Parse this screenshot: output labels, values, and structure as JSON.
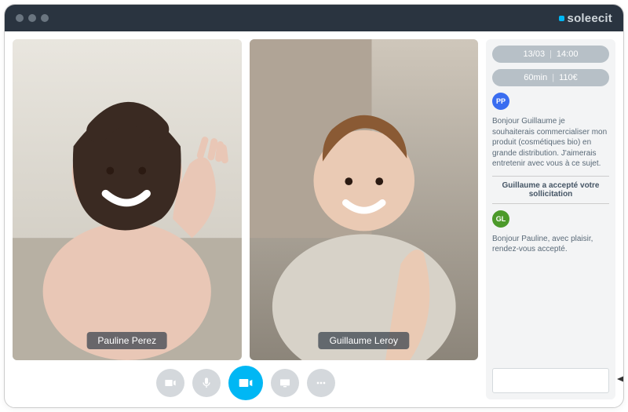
{
  "brand": "soleecit",
  "participants": [
    {
      "name": "Pauline Perez"
    },
    {
      "name": "Guillaume Leroy"
    }
  ],
  "meeting": {
    "date": "13/03",
    "time": "14:00",
    "duration": "60min",
    "price": "110€"
  },
  "chat": {
    "avatar1": "PP",
    "msg1": "Bonjour Guillaume je souhaiterais commercialiser mon produit (cosmétiques bio) en grande distribution. J'aimerais entretenir avec vous à ce sujet.",
    "system": "Guillaume a accepté votre sollicitation",
    "avatar2": "GL",
    "msg2": "Bonjour Pauline, avec plaisir, rendez-vous accepté."
  },
  "input": {
    "placeholder": ""
  },
  "controls": {
    "camera": "camera",
    "mic": "mic",
    "video": "video",
    "screen": "screen",
    "more": "…"
  }
}
